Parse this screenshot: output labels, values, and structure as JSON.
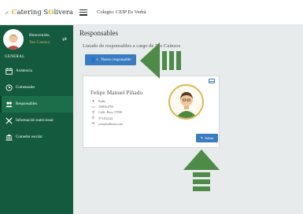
{
  "brand": {
    "initial": "C",
    "rest": "atering S",
    "accent_o": "O",
    "tail": "livera"
  },
  "sidebar": {
    "welcome": "Bienvenido,",
    "user": "Teo Caonzo",
    "section": "GENERAL",
    "items": [
      {
        "label": "Asistencia",
        "icon": "calendar-icon",
        "active": false
      },
      {
        "label": "Comensales",
        "icon": "clock-icon",
        "active": false
      },
      {
        "label": "Responsables",
        "icon": "users-icon",
        "active": true
      },
      {
        "label": "Información nutricional",
        "icon": "cutlery-icon",
        "active": false
      },
      {
        "label": "Comedor escolar",
        "icon": "building-icon",
        "active": false
      }
    ]
  },
  "topbar": {
    "school": "Colegio: CEIP Es Vedrà"
  },
  "main": {
    "title": "Responsables",
    "subtitle": "Listado de responsables a cargo de Teo Caínzos",
    "new_button": "Nuevo responsable"
  },
  "card": {
    "name": "Felipe Manuel Piñado",
    "rows": [
      {
        "icon": "user-icon",
        "text": "Padre"
      },
      {
        "icon": "id-card-icon",
        "text": "10083/4783"
      },
      {
        "icon": "map-pin-icon",
        "text": "Calle: Boss, 07800"
      },
      {
        "icon": "phone-icon",
        "text": "971452244"
      },
      {
        "icon": "mail-icon",
        "text": "you@asilberta.com"
      }
    ],
    "edit_button": "Editar"
  },
  "colors": {
    "sidebar": "#145a3e",
    "accent_blue": "#3a7cc0",
    "arrow_green": "#4e8a48",
    "gold": "#d8b85a"
  }
}
